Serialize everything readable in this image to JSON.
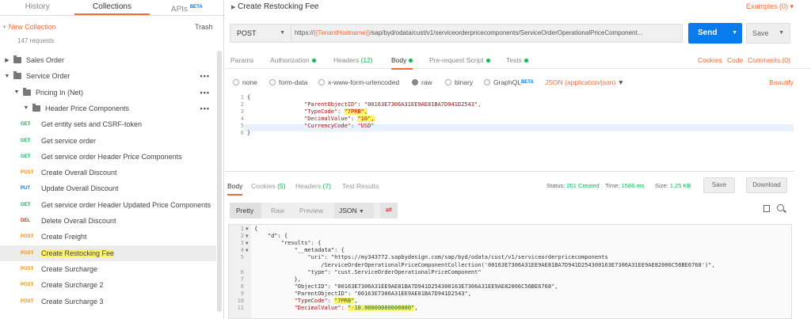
{
  "sidebar": {
    "tabs": [
      "History",
      "Collections",
      "APIs"
    ],
    "apis_badge": "BETA",
    "new_collection": "+ New Collection",
    "trash": "Trash",
    "request_count": "147 requests",
    "items": [
      {
        "label": "Sales Order",
        "type": "folder",
        "level": 0,
        "expanded": false,
        "more": false
      },
      {
        "label": "Service Order",
        "type": "folder",
        "level": 0,
        "expanded": true,
        "more": true
      },
      {
        "label": "Pricing In (Net)",
        "type": "folder",
        "level": 1,
        "expanded": true,
        "more": true
      },
      {
        "label": "Header Price Components",
        "type": "folder",
        "level": 2,
        "expanded": true,
        "more": true
      },
      {
        "label": "Get entity sets and CSRF-token",
        "method": "GET"
      },
      {
        "label": "Get service order",
        "method": "GET"
      },
      {
        "label": "Get service order Header Price Components",
        "method": "GET"
      },
      {
        "label": "Create Overall Discount",
        "method": "POST"
      },
      {
        "label": "Update Overall Discount",
        "method": "PUT"
      },
      {
        "label": "Get service order Header Updated Price Components",
        "method": "GET"
      },
      {
        "label": "Delete Overall Discount",
        "method": "DEL"
      },
      {
        "label": "Create Freight",
        "method": "POST"
      },
      {
        "label": "Create Restocking Fee",
        "method": "POST",
        "selected": true
      },
      {
        "label": "Create Surcharge",
        "method": "POST"
      },
      {
        "label": "Create Surcharge 2",
        "method": "POST"
      },
      {
        "label": "Create Surcharge 3",
        "method": "POST"
      }
    ]
  },
  "request": {
    "title": "Create Restocking Fee",
    "examples": "Examples (0)",
    "method": "POST",
    "url_prefix": "https://",
    "url_var": "{{TenantHostname}}",
    "url_rest": "/sap/byd/odata/cust/v1/serviceorderpricecomponents/ServiceOrderOperationalPriceComponent...",
    "send": "Send",
    "save": "Save",
    "tabs": {
      "params": "Params",
      "authorization": "Authorization",
      "headers": "Headers",
      "headers_count": "(12)",
      "body": "Body",
      "prerequest": "Pre-request Script",
      "tests": "Tests"
    },
    "right_links": {
      "cookies": "Cookies",
      "code": "Code",
      "comments": "Comments (0)"
    },
    "body_types": [
      "none",
      "form-data",
      "x-www-form-urlencoded",
      "raw",
      "binary",
      "GraphQL"
    ],
    "graphql_badge": "BETA",
    "content_type": "JSON (application/json)",
    "beautify": "Beautify",
    "body_lines": [
      {
        "n": "1",
        "text": "{"
      },
      {
        "n": "2",
        "key": "\"ParentObjectID\"",
        "val": "\"00163E7306A31EE9AE81BA7D941D2543\","
      },
      {
        "n": "3",
        "key": "\"TypeCode\"",
        "val": "\"7PRB\","
      },
      {
        "n": "4",
        "key": "\"DecimalValue\"",
        "val": "\"10\","
      },
      {
        "n": "5",
        "key": "\"CurrencyCode\"",
        "val": "\"USD\""
      },
      {
        "n": "6",
        "text": "}"
      }
    ]
  },
  "response": {
    "tabs": {
      "body": "Body",
      "cookies": "Cookies",
      "cookies_count": "(5)",
      "headers": "Headers",
      "headers_count": "(7)",
      "test_results": "Test Results"
    },
    "status_label": "Status:",
    "status_value": "201 Created",
    "time_label": "Time:",
    "time_value": "1586 ms",
    "size_label": "Size:",
    "size_value": "1.25 KB",
    "save": "Save",
    "download": "Download",
    "views": [
      "Pretty",
      "Raw",
      "Preview"
    ],
    "format": "JSON",
    "lines": [
      {
        "n": "1",
        "t": "{"
      },
      {
        "n": "2",
        "t": "    \"d\": {"
      },
      {
        "n": "3",
        "t": "        \"results\": {"
      },
      {
        "n": "4",
        "t": "            \"__metadata\": {"
      },
      {
        "n": "5",
        "t": "                \"uri\": \"https://my343772.sapbydesign.com/sap/byd/odata/cust/v1/serviceorderpricecomponents"
      },
      {
        "n": "",
        "t": "                    /ServiceOrderOperationalPriceComponentCollection('00163E7306A31EE9AE81BA7D941D254300163E7306A31EE9AE82006C56BE6768')\","
      },
      {
        "n": "6",
        "t": "                \"type\": \"cust.ServiceOrderOperationalPriceComponent\""
      },
      {
        "n": "7",
        "t": "            },"
      },
      {
        "n": "8",
        "t": "            \"ObjectID\": \"00163E7306A31EE9AE81BA7D941D254300163E7306A31EE9AE82006C56BE6768\","
      },
      {
        "n": "9",
        "t": "            \"ParentObjectID\": \"00163E7306A31EE9AE81BA7D941D2543\","
      },
      {
        "n": "10",
        "t": "            \"TypeCode\": \"7PRB\","
      },
      {
        "n": "11",
        "t": "            \"DecimalValue\": \"-10.00000000000000\","
      }
    ]
  },
  "colors": {
    "accent": "#f26b3a",
    "send": "#097bed",
    "get": "#0cbb52",
    "post": "#ff8f00",
    "put": "#097bed",
    "del": "#eb2013",
    "highlight": "#fff36a"
  }
}
